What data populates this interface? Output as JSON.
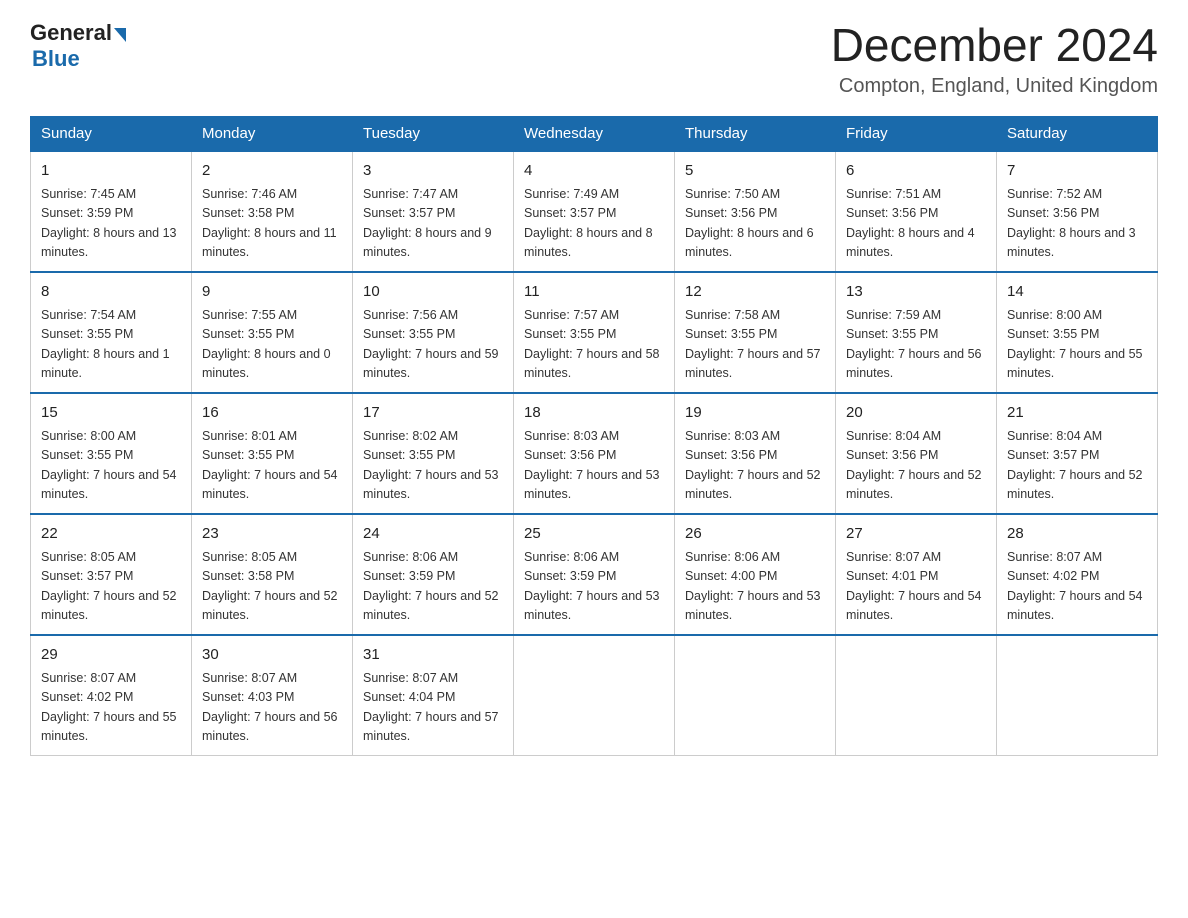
{
  "header": {
    "logo_general": "General",
    "logo_blue": "Blue",
    "month_title": "December 2024",
    "location": "Compton, England, United Kingdom"
  },
  "columns": [
    "Sunday",
    "Monday",
    "Tuesday",
    "Wednesday",
    "Thursday",
    "Friday",
    "Saturday"
  ],
  "weeks": [
    [
      {
        "day": "1",
        "sunrise": "7:45 AM",
        "sunset": "3:59 PM",
        "daylight": "8 hours and 13 minutes."
      },
      {
        "day": "2",
        "sunrise": "7:46 AM",
        "sunset": "3:58 PM",
        "daylight": "8 hours and 11 minutes."
      },
      {
        "day": "3",
        "sunrise": "7:47 AM",
        "sunset": "3:57 PM",
        "daylight": "8 hours and 9 minutes."
      },
      {
        "day": "4",
        "sunrise": "7:49 AM",
        "sunset": "3:57 PM",
        "daylight": "8 hours and 8 minutes."
      },
      {
        "day": "5",
        "sunrise": "7:50 AM",
        "sunset": "3:56 PM",
        "daylight": "8 hours and 6 minutes."
      },
      {
        "day": "6",
        "sunrise": "7:51 AM",
        "sunset": "3:56 PM",
        "daylight": "8 hours and 4 minutes."
      },
      {
        "day": "7",
        "sunrise": "7:52 AM",
        "sunset": "3:56 PM",
        "daylight": "8 hours and 3 minutes."
      }
    ],
    [
      {
        "day": "8",
        "sunrise": "7:54 AM",
        "sunset": "3:55 PM",
        "daylight": "8 hours and 1 minute."
      },
      {
        "day": "9",
        "sunrise": "7:55 AM",
        "sunset": "3:55 PM",
        "daylight": "8 hours and 0 minutes."
      },
      {
        "day": "10",
        "sunrise": "7:56 AM",
        "sunset": "3:55 PM",
        "daylight": "7 hours and 59 minutes."
      },
      {
        "day": "11",
        "sunrise": "7:57 AM",
        "sunset": "3:55 PM",
        "daylight": "7 hours and 58 minutes."
      },
      {
        "day": "12",
        "sunrise": "7:58 AM",
        "sunset": "3:55 PM",
        "daylight": "7 hours and 57 minutes."
      },
      {
        "day": "13",
        "sunrise": "7:59 AM",
        "sunset": "3:55 PM",
        "daylight": "7 hours and 56 minutes."
      },
      {
        "day": "14",
        "sunrise": "8:00 AM",
        "sunset": "3:55 PM",
        "daylight": "7 hours and 55 minutes."
      }
    ],
    [
      {
        "day": "15",
        "sunrise": "8:00 AM",
        "sunset": "3:55 PM",
        "daylight": "7 hours and 54 minutes."
      },
      {
        "day": "16",
        "sunrise": "8:01 AM",
        "sunset": "3:55 PM",
        "daylight": "7 hours and 54 minutes."
      },
      {
        "day": "17",
        "sunrise": "8:02 AM",
        "sunset": "3:55 PM",
        "daylight": "7 hours and 53 minutes."
      },
      {
        "day": "18",
        "sunrise": "8:03 AM",
        "sunset": "3:56 PM",
        "daylight": "7 hours and 53 minutes."
      },
      {
        "day": "19",
        "sunrise": "8:03 AM",
        "sunset": "3:56 PM",
        "daylight": "7 hours and 52 minutes."
      },
      {
        "day": "20",
        "sunrise": "8:04 AM",
        "sunset": "3:56 PM",
        "daylight": "7 hours and 52 minutes."
      },
      {
        "day": "21",
        "sunrise": "8:04 AM",
        "sunset": "3:57 PM",
        "daylight": "7 hours and 52 minutes."
      }
    ],
    [
      {
        "day": "22",
        "sunrise": "8:05 AM",
        "sunset": "3:57 PM",
        "daylight": "7 hours and 52 minutes."
      },
      {
        "day": "23",
        "sunrise": "8:05 AM",
        "sunset": "3:58 PM",
        "daylight": "7 hours and 52 minutes."
      },
      {
        "day": "24",
        "sunrise": "8:06 AM",
        "sunset": "3:59 PM",
        "daylight": "7 hours and 52 minutes."
      },
      {
        "day": "25",
        "sunrise": "8:06 AM",
        "sunset": "3:59 PM",
        "daylight": "7 hours and 53 minutes."
      },
      {
        "day": "26",
        "sunrise": "8:06 AM",
        "sunset": "4:00 PM",
        "daylight": "7 hours and 53 minutes."
      },
      {
        "day": "27",
        "sunrise": "8:07 AM",
        "sunset": "4:01 PM",
        "daylight": "7 hours and 54 minutes."
      },
      {
        "day": "28",
        "sunrise": "8:07 AM",
        "sunset": "4:02 PM",
        "daylight": "7 hours and 54 minutes."
      }
    ],
    [
      {
        "day": "29",
        "sunrise": "8:07 AM",
        "sunset": "4:02 PM",
        "daylight": "7 hours and 55 minutes."
      },
      {
        "day": "30",
        "sunrise": "8:07 AM",
        "sunset": "4:03 PM",
        "daylight": "7 hours and 56 minutes."
      },
      {
        "day": "31",
        "sunrise": "8:07 AM",
        "sunset": "4:04 PM",
        "daylight": "7 hours and 57 minutes."
      },
      null,
      null,
      null,
      null
    ]
  ]
}
